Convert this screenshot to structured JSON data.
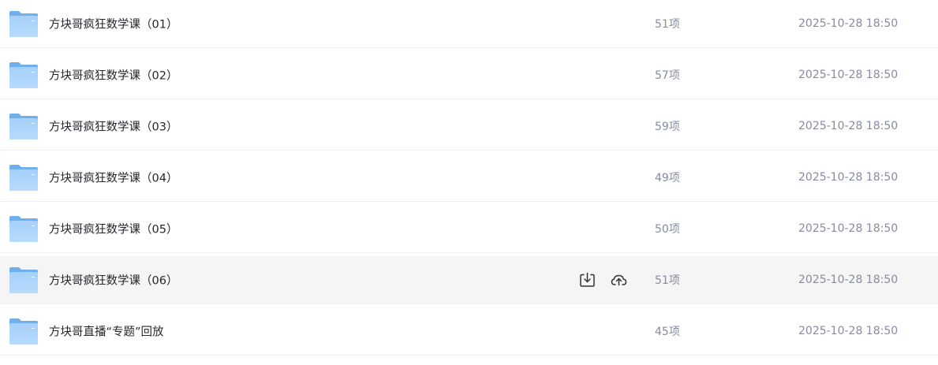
{
  "files": [
    {
      "name": "方块哥疯狂数学课（01）",
      "count": "51项",
      "date": "2025-10-28 18:50",
      "icon": "folder-icon"
    },
    {
      "name": "方块哥疯狂数学课（02）",
      "count": "57项",
      "date": "2025-10-28 18:50",
      "icon": "folder-icon"
    },
    {
      "name": "方块哥疯狂数学课（03）",
      "count": "59项",
      "date": "2025-10-28 18:50",
      "icon": "folder-icon"
    },
    {
      "name": "方块哥疯狂数学课（04）",
      "count": "49项",
      "date": "2025-10-28 18:50",
      "icon": "folder-icon"
    },
    {
      "name": "方块哥疯狂数学课（05）",
      "count": "50项",
      "date": "2025-10-28 18:50",
      "icon": "folder-icon"
    },
    {
      "name": "方块哥疯狂数学课（06）",
      "count": "51项",
      "date": "2025-10-28 18:50",
      "icon": "folder-icon",
      "hovered": true
    },
    {
      "name": "方块哥直播“专题”回放",
      "count": "45项",
      "date": "2025-10-28 18:50",
      "icon": "folder-icon"
    }
  ],
  "hover_actions": [
    {
      "icon": "download-icon"
    },
    {
      "icon": "save-to-cloud-icon"
    }
  ],
  "colors": {
    "folder_back": "#6fb0ec",
    "folder_front": "#a9d3fb",
    "hover_bg": "#f5f5f5",
    "name_text": "#25262b",
    "meta_text": "#878c9c"
  }
}
